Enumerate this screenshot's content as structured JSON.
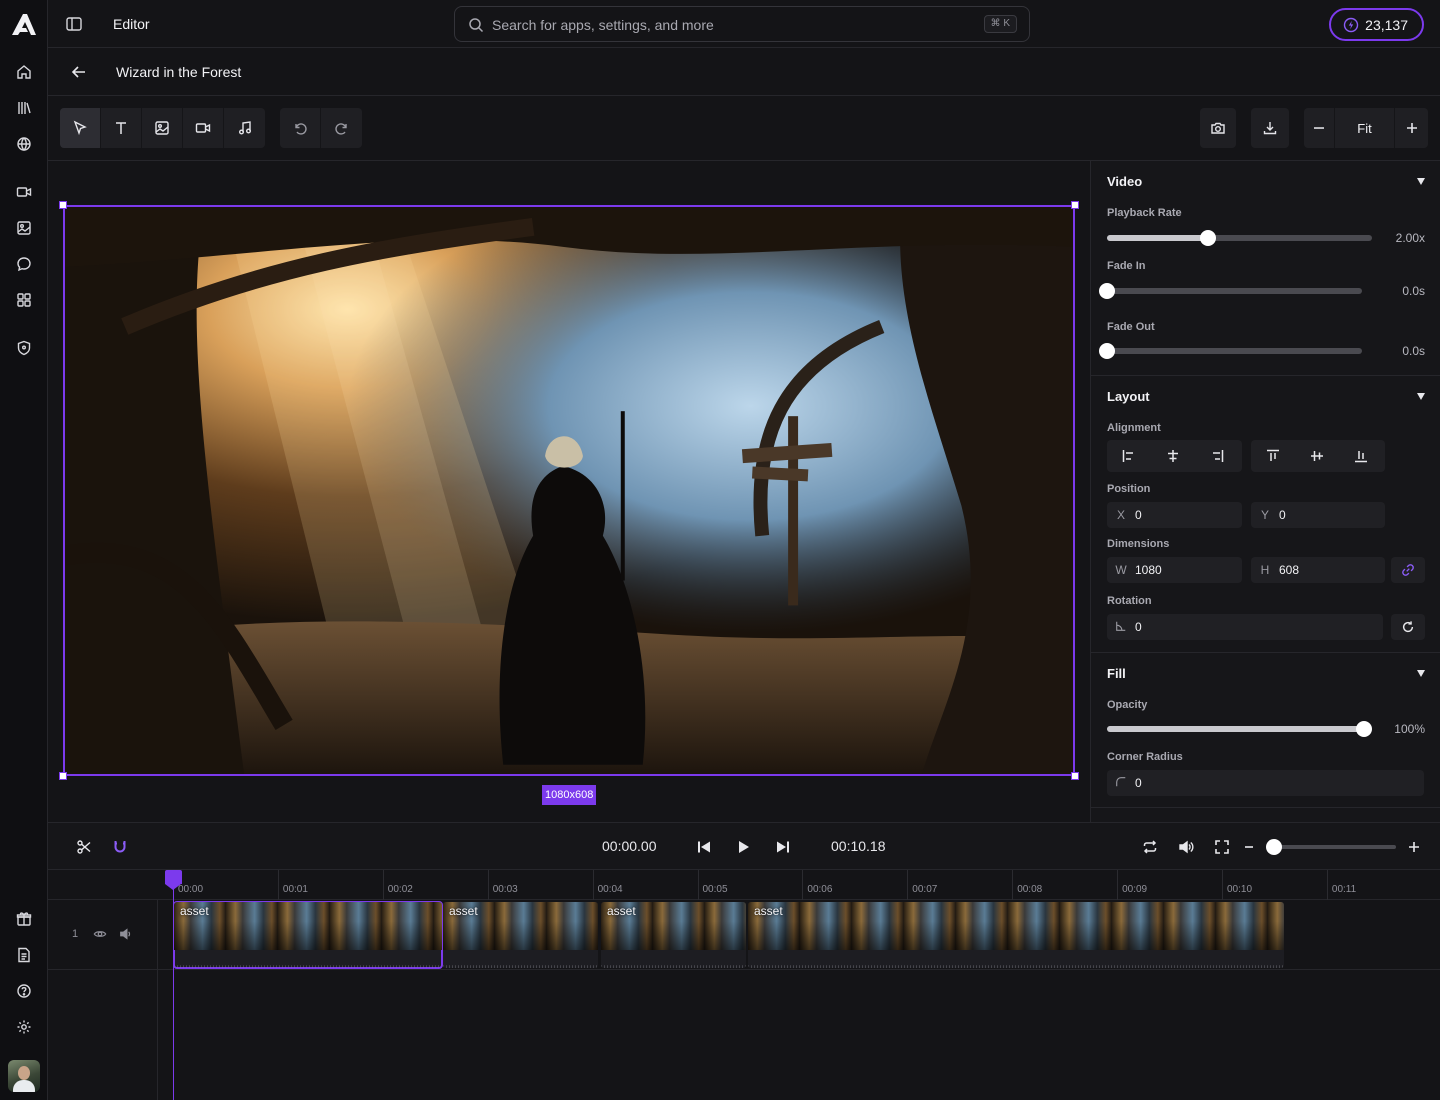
{
  "app": {
    "title": "Editor",
    "credits": "23,137",
    "accent": "#7c3aed"
  },
  "search": {
    "placeholder": "Search for apps, settings, and more",
    "shortcut": "⌘ K"
  },
  "project": {
    "title": "Wizard in the Forest"
  },
  "rail": {
    "top_icons": [
      "home-icon",
      "library-icon",
      "globe-icon",
      "video-icon",
      "image-icon",
      "chat-icon",
      "apps-grid-icon",
      "shield-icon"
    ],
    "bottom_icons": [
      "gift-icon",
      "document-icon",
      "help-icon",
      "settings-icon"
    ]
  },
  "toolbar": {
    "tools": [
      "select-tool-icon",
      "text-tool-icon",
      "image-tool-icon",
      "video-tool-icon",
      "audio-tool-icon"
    ],
    "zoom_label": "Fit"
  },
  "canvas": {
    "dimensions_badge": "1080x608"
  },
  "panel": {
    "video": {
      "title": "Video",
      "playback_rate_label": "Playback Rate",
      "playback_rate_value": "2.00x",
      "playback_rate_fraction": 0.38,
      "fade_in_label": "Fade In",
      "fade_in_value": "0.0s",
      "fade_in_fraction": 0,
      "fade_out_label": "Fade Out",
      "fade_out_value": "0.0s",
      "fade_out_fraction": 0
    },
    "layout": {
      "title": "Layout",
      "alignment_label": "Alignment",
      "position_label": "Position",
      "x_label": "X",
      "x_value": "0",
      "y_label": "Y",
      "y_value": "0",
      "dimensions_label": "Dimensions",
      "w_label": "W",
      "w_value": "1080",
      "h_label": "H",
      "h_value": "608",
      "rotation_label": "Rotation",
      "rotation_value": "0"
    },
    "fill": {
      "title": "Fill",
      "opacity_label": "Opacity",
      "opacity_value": "100%",
      "opacity_fraction": 1,
      "corner_radius_label": "Corner Radius",
      "corner_radius_value": "0"
    }
  },
  "transport": {
    "current_time": "00:00.00",
    "duration": "00:10.18",
    "zoom_fraction": 0
  },
  "timeline": {
    "ticks": [
      "00:00",
      "00:01",
      "00:02",
      "00:03",
      "00:04",
      "00:05",
      "00:06",
      "00:07",
      "00:08",
      "00:09",
      "00:10",
      "00:11"
    ],
    "track_number": "1",
    "clips": [
      {
        "label": "asset",
        "selected": true
      },
      {
        "label": "asset",
        "selected": false
      },
      {
        "label": "asset",
        "selected": false
      },
      {
        "label": "asset",
        "selected": false
      }
    ]
  }
}
